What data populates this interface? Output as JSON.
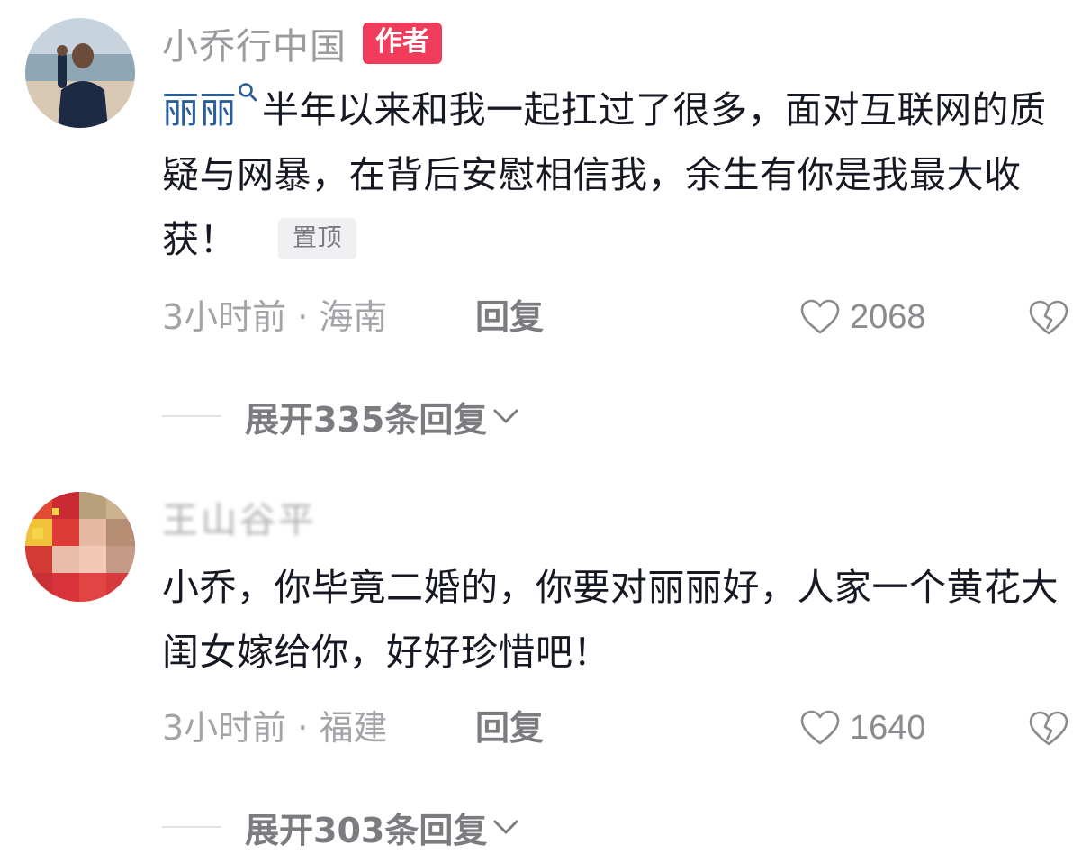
{
  "comments": [
    {
      "avatar_icon": "user-avatar-photo",
      "username": "小乔行中国",
      "author_badge": "作者",
      "mention": "丽丽",
      "text": "半年以来和我一起扛过了很多，面对互联网的质疑与网暴，在背后安慰相信我，余生有你是我最大收获！",
      "pin_badge": "置顶",
      "time_location": "3小时前 · 海南",
      "reply_label": "回复",
      "like_count": "2068",
      "expand_label": "展开335条回复"
    },
    {
      "avatar_icon": "user-avatar-photo-pixelated",
      "username": "王山谷平",
      "text": "小乔，你毕竟二婚的，你要对丽丽好，人家一个黄花大闺女嫁给你，好好珍惜吧！",
      "time_location": "3小时前 · 福建",
      "reply_label": "回复",
      "like_count": "1640",
      "expand_label": "展开303条回复"
    }
  ],
  "colors": {
    "author_badge_bg": "#f23c5b",
    "mention": "#2a5d9c",
    "secondary_text": "#a3a3a8"
  }
}
